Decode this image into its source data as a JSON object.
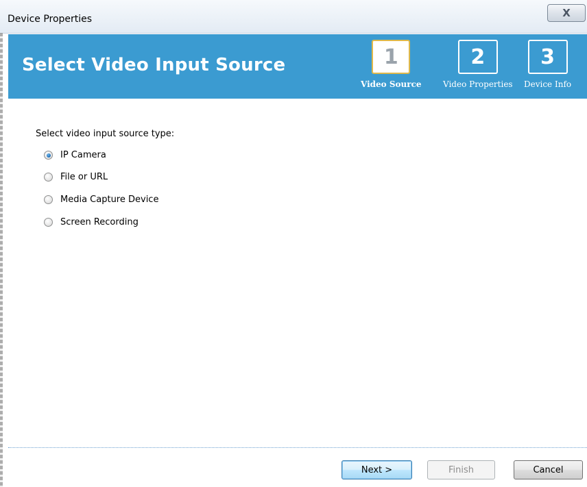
{
  "window": {
    "title": "Device Properties",
    "close_glyph": "X"
  },
  "header": {
    "title": "Select Video Input Source",
    "steps": [
      {
        "number": "1",
        "label": "Video Source",
        "active": true
      },
      {
        "number": "2",
        "label": "Video Properties",
        "active": false
      },
      {
        "number": "3",
        "label": "Device Info",
        "active": false
      }
    ]
  },
  "main": {
    "prompt": "Select video input source type:",
    "options": [
      {
        "label": "IP Camera",
        "checked": true
      },
      {
        "label": "File or URL",
        "checked": false
      },
      {
        "label": "Media Capture Device",
        "checked": false
      },
      {
        "label": "Screen Recording",
        "checked": false
      }
    ]
  },
  "footer": {
    "next_label": "Next >",
    "finish_label": "Finish",
    "cancel_label": "Cancel"
  },
  "colors": {
    "header_band": "#3b9bd1",
    "active_step_border": "#e0b84a"
  },
  "icons": {
    "close": "close-icon",
    "radio_checked": "radio-checked-icon",
    "radio_unchecked": "radio-unchecked-icon"
  }
}
